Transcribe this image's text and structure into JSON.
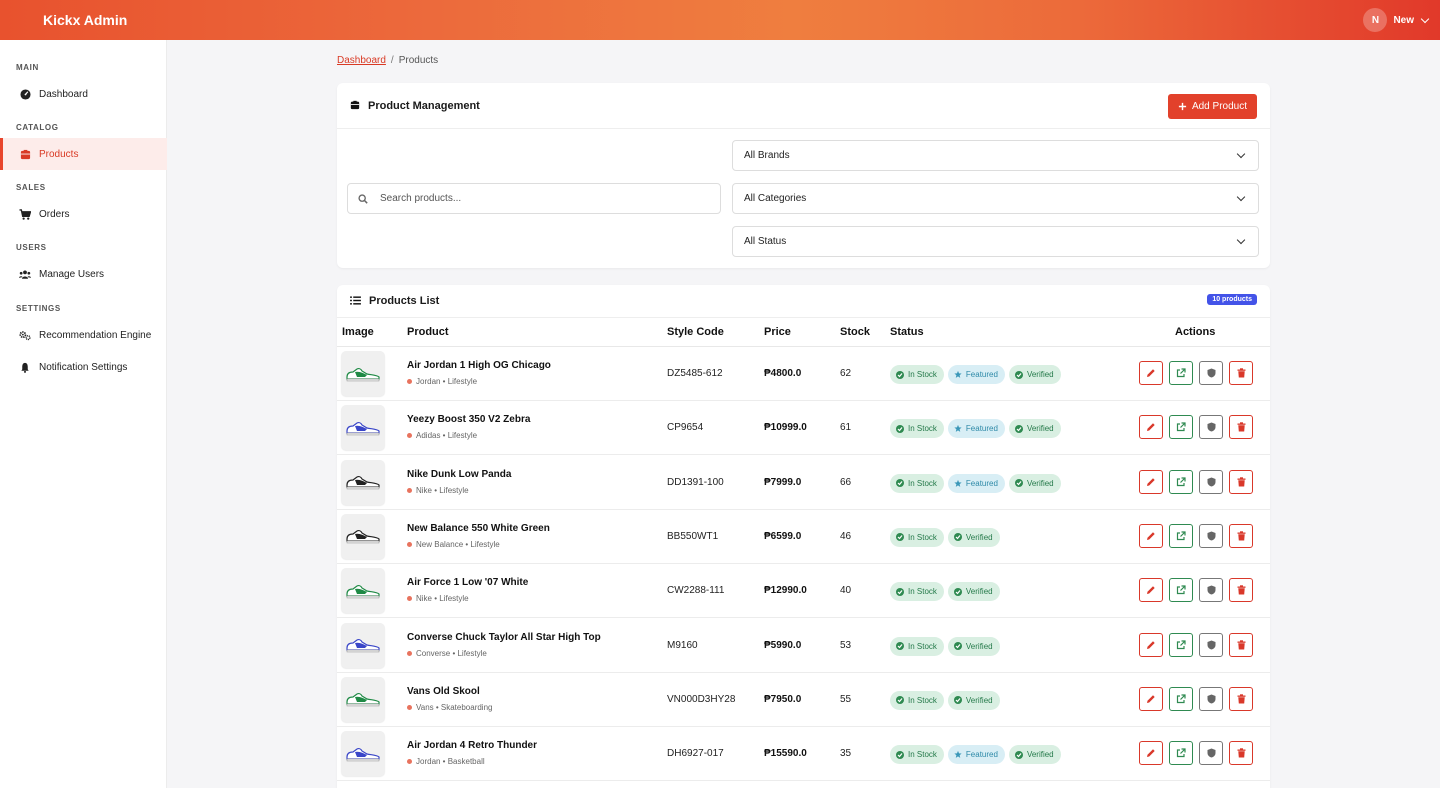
{
  "app": {
    "brand": "Kickx Admin",
    "user_initial": "N",
    "user_name": "New"
  },
  "sidebar": {
    "sections": [
      {
        "label": "MAIN",
        "items": [
          {
            "label": "Dashboard",
            "icon": "dashboard-icon"
          }
        ]
      },
      {
        "label": "CATALOG",
        "items": [
          {
            "label": "Products",
            "icon": "box-icon",
            "active": true
          }
        ]
      },
      {
        "label": "SALES",
        "items": [
          {
            "label": "Orders",
            "icon": "cart-icon"
          }
        ]
      },
      {
        "label": "USERS",
        "items": [
          {
            "label": "Manage Users",
            "icon": "users-icon"
          }
        ]
      },
      {
        "label": "SETTINGS",
        "items": [
          {
            "label": "Recommendation Engine",
            "icon": "gears-icon"
          },
          {
            "label": "Notification Settings",
            "icon": "bell-icon"
          }
        ]
      }
    ]
  },
  "breadcrumb": {
    "root": "Dashboard",
    "current": "Products"
  },
  "management": {
    "title": "Product Management",
    "add_label": "Add Product",
    "search_placeholder": "Search products...",
    "filters": [
      "All Brands",
      "All Categories",
      "All Status"
    ]
  },
  "list": {
    "title": "Products List",
    "count_label": "10 products",
    "columns": [
      "Image",
      "Product",
      "Style Code",
      "Price",
      "Stock",
      "Status",
      "Actions"
    ],
    "rows": [
      {
        "name": "Air Jordan 1 High OG Chicago",
        "meta": "Jordan • Lifestyle",
        "code": "DZ5485-612",
        "price": "₱4800.0",
        "stock": "62",
        "badges": [
          "In Stock",
          "Featured",
          "Verified"
        ],
        "thumb": "green"
      },
      {
        "name": "Yeezy Boost 350 V2 Zebra",
        "meta": "Adidas • Lifestyle",
        "code": "CP9654",
        "price": "₱10999.0",
        "stock": "61",
        "badges": [
          "In Stock",
          "Featured",
          "Verified"
        ],
        "thumb": "blue"
      },
      {
        "name": "Nike Dunk Low Panda",
        "meta": "Nike • Lifestyle",
        "code": "DD1391-100",
        "price": "₱7999.0",
        "stock": "66",
        "badges": [
          "In Stock",
          "Featured",
          "Verified"
        ],
        "thumb": "black"
      },
      {
        "name": "New Balance 550 White Green",
        "meta": "New Balance • Lifestyle",
        "code": "BB550WT1",
        "price": "₱6599.0",
        "stock": "46",
        "badges": [
          "In Stock",
          "Verified"
        ],
        "thumb": "black"
      },
      {
        "name": "Air Force 1 Low '07 White",
        "meta": "Nike • Lifestyle",
        "code": "CW2288-111",
        "price": "₱12990.0",
        "stock": "40",
        "badges": [
          "In Stock",
          "Verified"
        ],
        "thumb": "green"
      },
      {
        "name": "Converse Chuck Taylor All Star High Top",
        "meta": "Converse • Lifestyle",
        "code": "M9160",
        "price": "₱5990.0",
        "stock": "53",
        "badges": [
          "In Stock",
          "Verified"
        ],
        "thumb": "blue"
      },
      {
        "name": "Vans Old Skool",
        "meta": "Vans • Skateboarding",
        "code": "VN000D3HY28",
        "price": "₱7950.0",
        "stock": "55",
        "badges": [
          "In Stock",
          "Verified"
        ],
        "thumb": "green"
      },
      {
        "name": "Air Jordan 4 Retro Thunder",
        "meta": "Jordan • Basketball",
        "code": "DH6927-017",
        "price": "₱15590.0",
        "stock": "35",
        "badges": [
          "In Stock",
          "Featured",
          "Verified"
        ],
        "thumb": "blue"
      }
    ]
  },
  "colors": {
    "accent": "#e2412b",
    "badge_blue": "#4353e8",
    "stock_green": "#257a4a",
    "featured_blue": "#2e8aa8"
  }
}
